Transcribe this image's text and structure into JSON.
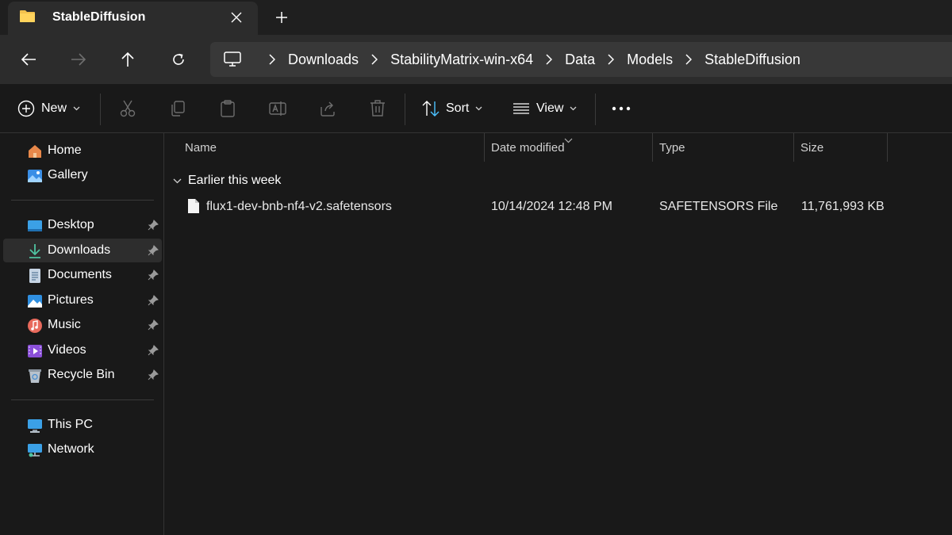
{
  "tab": {
    "title": "StableDiffusion"
  },
  "breadcrumb": [
    "Downloads",
    "StabilityMatrix-win-x64",
    "Data",
    "Models",
    "StableDiffusion"
  ],
  "toolbar": {
    "new_label": "New",
    "sort_label": "Sort",
    "view_label": "View"
  },
  "sidebar": {
    "top": [
      {
        "label": "Home",
        "icon": "home-icon"
      },
      {
        "label": "Gallery",
        "icon": "gallery-icon"
      }
    ],
    "pinned": [
      {
        "label": "Desktop",
        "icon": "desktop-icon"
      },
      {
        "label": "Downloads",
        "icon": "downloads-icon",
        "selected": true
      },
      {
        "label": "Documents",
        "icon": "documents-icon"
      },
      {
        "label": "Pictures",
        "icon": "pictures-icon"
      },
      {
        "label": "Music",
        "icon": "music-icon"
      },
      {
        "label": "Videos",
        "icon": "videos-icon"
      },
      {
        "label": "Recycle Bin",
        "icon": "recycle-bin-icon"
      }
    ],
    "bottom": [
      {
        "label": "This PC",
        "icon": "this-pc-icon"
      },
      {
        "label": "Network",
        "icon": "network-icon"
      }
    ]
  },
  "columns": {
    "name": "Name",
    "date": "Date modified",
    "type": "Type",
    "size": "Size"
  },
  "group": {
    "label": "Earlier this week"
  },
  "files": [
    {
      "name": "flux1-dev-bnb-nf4-v2.safetensors",
      "date": "10/14/2024 12:48 PM",
      "type": "SAFETENSORS File",
      "size": "11,761,993 KB"
    }
  ],
  "colors": {
    "background": "#191919",
    "chrome": "#2c2c2c",
    "accent": "#4cc2ff"
  }
}
